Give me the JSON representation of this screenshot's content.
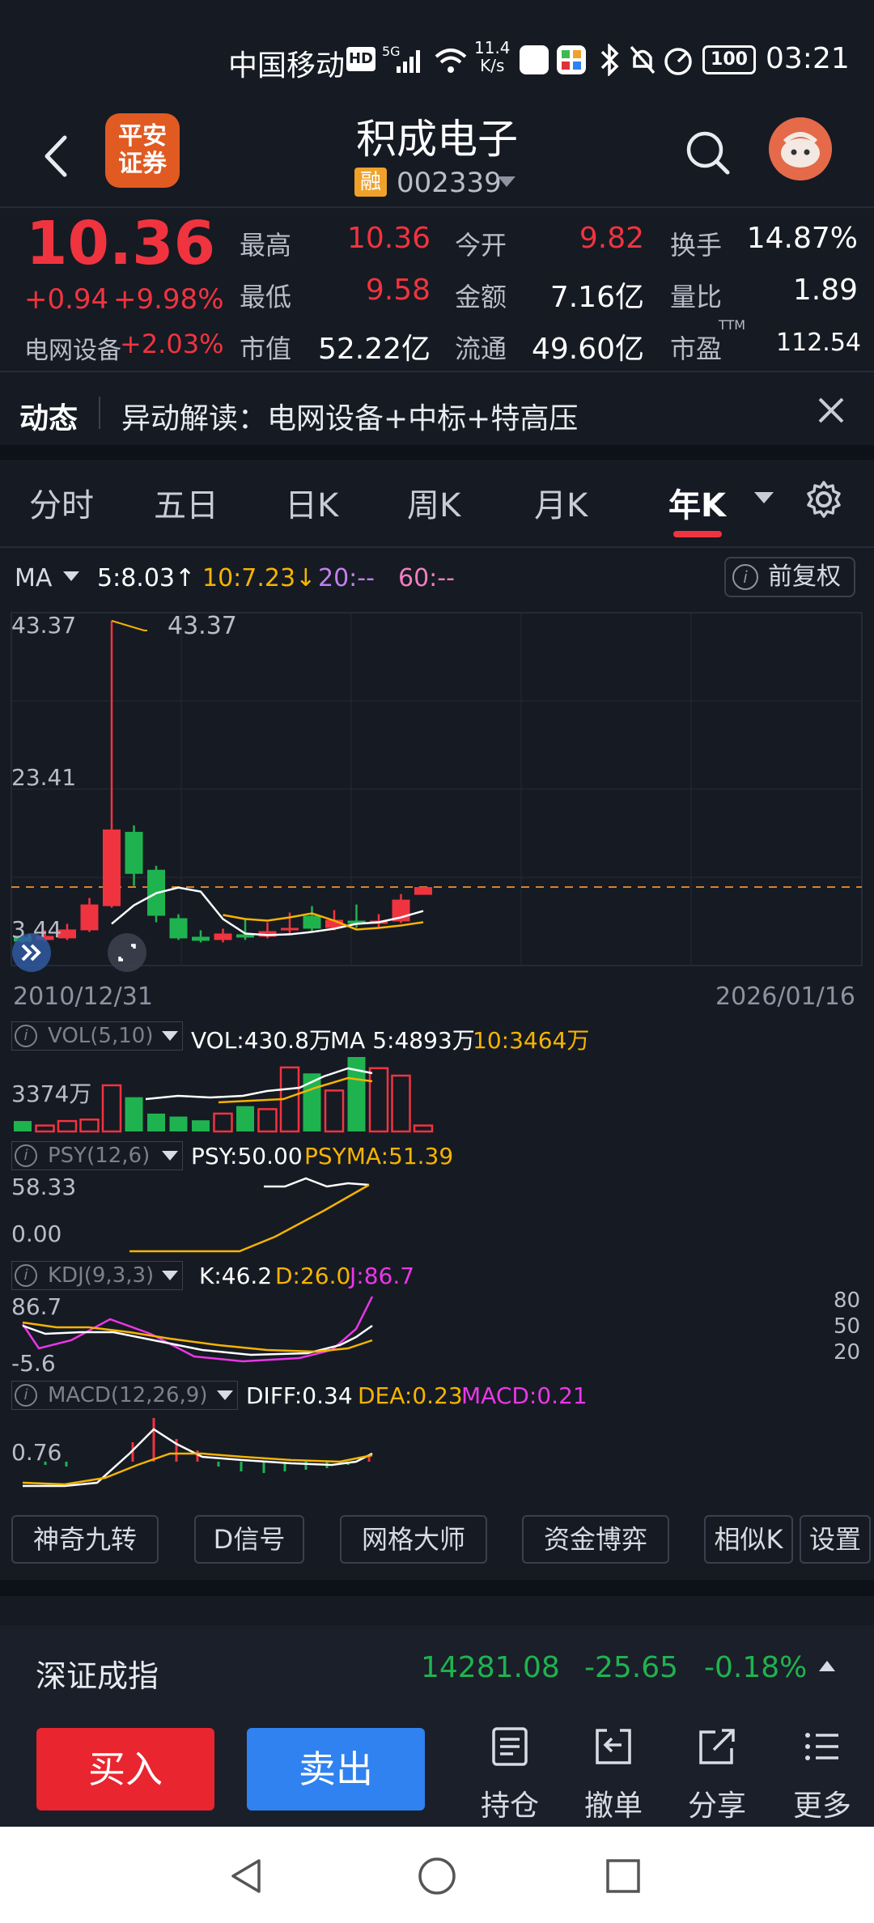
{
  "status_bar": {
    "carrier": "中国移动",
    "hd": "HD",
    "net": "5G",
    "speed_top": "11.4",
    "speed_bottom": "K/s",
    "battery": "100",
    "time": "03:21"
  },
  "header": {
    "broker_line1": "平安",
    "broker_line2": "证券",
    "stock_name": "积成电子",
    "badge": "融",
    "stock_code": "002339"
  },
  "quote": {
    "price": "10.36",
    "change_abs": "+0.94",
    "change_pct": "+9.98%",
    "sector_label": "电网设备",
    "sector_change": "+2.03%",
    "fields": {
      "high_label": "最高",
      "high": "10.36",
      "open_label": "今开",
      "open": "9.82",
      "turnover_label": "换手",
      "turnover": "14.87%",
      "low_label": "最低",
      "low": "9.58",
      "amount_label": "金额",
      "amount": "7.16亿",
      "vol_ratio_label": "量比",
      "vol_ratio": "1.89",
      "mktcap_label": "市值",
      "mktcap": "52.22亿",
      "float_label": "流通",
      "float": "49.60亿",
      "pe_label": "市盈",
      "pe_sup": "TTM",
      "pe": "112.54"
    }
  },
  "news": {
    "tag": "动态",
    "text": "异动解读：电网设备+中标+特高压"
  },
  "tabs": {
    "t1": "分时",
    "t2": "五日",
    "t3": "日K",
    "t4": "周K",
    "t5": "月K",
    "t6": "年K"
  },
  "ma_legend": {
    "ma": "MA",
    "ma5": "5:8.03↑",
    "ma10": "10:7.23↓",
    "ma20": "20:--",
    "ma60": "60:--",
    "fuquan": "前复权"
  },
  "kline": {
    "y_top": "43.37",
    "y_mid": "23.41",
    "y_low": "3.44",
    "max_marker": "43.37",
    "date_start": "2010/12/31",
    "date_end": "2026/01/16",
    "candles": [
      {
        "o": 4.2,
        "c": 3.6,
        "h": 4.6,
        "l": 3.44
      },
      {
        "o": 3.8,
        "c": 4.3,
        "h": 5.0,
        "l": 3.6
      },
      {
        "o": 4.0,
        "c": 5.1,
        "h": 5.8,
        "l": 3.8
      },
      {
        "o": 5.0,
        "c": 8.2,
        "h": 9.0,
        "l": 4.8
      },
      {
        "o": 8.0,
        "c": 17.5,
        "h": 43.37,
        "l": 7.8
      },
      {
        "o": 17.2,
        "c": 12.0,
        "h": 18.0,
        "l": 10.5
      },
      {
        "o": 12.5,
        "c": 6.8,
        "h": 13.0,
        "l": 6.0
      },
      {
        "o": 6.5,
        "c": 4.0,
        "h": 7.0,
        "l": 3.8
      },
      {
        "o": 4.2,
        "c": 3.7,
        "h": 5.0,
        "l": 3.5
      },
      {
        "o": 3.8,
        "c": 4.6,
        "h": 5.2,
        "l": 3.5
      },
      {
        "o": 4.5,
        "c": 4.1,
        "h": 6.5,
        "l": 3.8
      },
      {
        "o": 4.2,
        "c": 4.9,
        "h": 6.0,
        "l": 4.0
      },
      {
        "o": 5.0,
        "c": 5.3,
        "h": 7.2,
        "l": 4.5
      },
      {
        "o": 6.8,
        "c": 5.2,
        "h": 8.0,
        "l": 4.9
      },
      {
        "o": 5.3,
        "c": 6.3,
        "h": 7.5,
        "l": 5.0
      },
      {
        "o": 6.2,
        "c": 5.8,
        "h": 8.2,
        "l": 5.3
      },
      {
        "o": 5.8,
        "c": 6.2,
        "h": 7.0,
        "l": 5.4
      },
      {
        "o": 6.1,
        "c": 8.8,
        "h": 9.5,
        "l": 5.9
      },
      {
        "o": 9.4,
        "c": 10.36,
        "h": 10.36,
        "l": 9.4
      }
    ],
    "ma5_line": [
      null,
      null,
      null,
      null,
      5.8,
      8.1,
      9.6,
      10.3,
      9.8,
      6.4,
      4.6,
      4.4,
      4.5,
      4.8,
      5.2,
      5.8,
      6.0,
      6.6,
      7.4
    ],
    "ma10_line": [
      null,
      null,
      null,
      null,
      null,
      null,
      null,
      null,
      null,
      6.9,
      6.4,
      6.2,
      6.6,
      7.1,
      6.2,
      5.1,
      5.3,
      5.6,
      6.0
    ]
  },
  "vol": {
    "label": "VOL(5,10)",
    "val": "VOL:430.8万",
    "ma5": "MA 5:4893万",
    "ma10": "10:3464万",
    "axis": "3374万",
    "bars": [
      0.14,
      0.08,
      0.14,
      0.16,
      0.62,
      0.46,
      0.24,
      0.2,
      0.15,
      0.24,
      0.34,
      0.3,
      0.86,
      0.78,
      0.55,
      1.0,
      0.85,
      0.75,
      0.08
    ]
  },
  "psy": {
    "label": "PSY(12,6)",
    "val": "PSY:50.00",
    "psyma": "PSYMA:51.39",
    "axis_top": "58.33",
    "axis_bottom": "0.00"
  },
  "kdj": {
    "label": "KDJ(9,3,3)",
    "k": "K:46.2",
    "d": "D:26.0",
    "j": "J:86.7",
    "axis_top": "86.7",
    "axis_bottom": "-5.6",
    "level_80": "80",
    "level_50": "50",
    "level_20": "20"
  },
  "macd": {
    "label": "MACD(12,26,9)",
    "diff": "DIFF:0.34",
    "dea": "DEA:0.23",
    "macd": "MACD:0.21",
    "axis": "0.76"
  },
  "tools": [
    "神奇九转",
    "D信号",
    "网格大师",
    "资金博弈",
    "相似K",
    "设置"
  ],
  "index_bar": {
    "name": "深证成指",
    "value": "14281.08",
    "change": "-25.65",
    "pct": "-0.18%"
  },
  "actions": {
    "buy": "买入",
    "sell": "卖出",
    "position": "持仓",
    "cancel": "撤单",
    "share": "分享",
    "more": "更多"
  },
  "colors": {
    "up": "#f0343f",
    "down": "#1fb34f",
    "ma5": "#ffffff",
    "ma10": "#f5b400",
    "ma20": "#c37ff0",
    "ma60": "#f07fc0",
    "background": "#161a23"
  }
}
